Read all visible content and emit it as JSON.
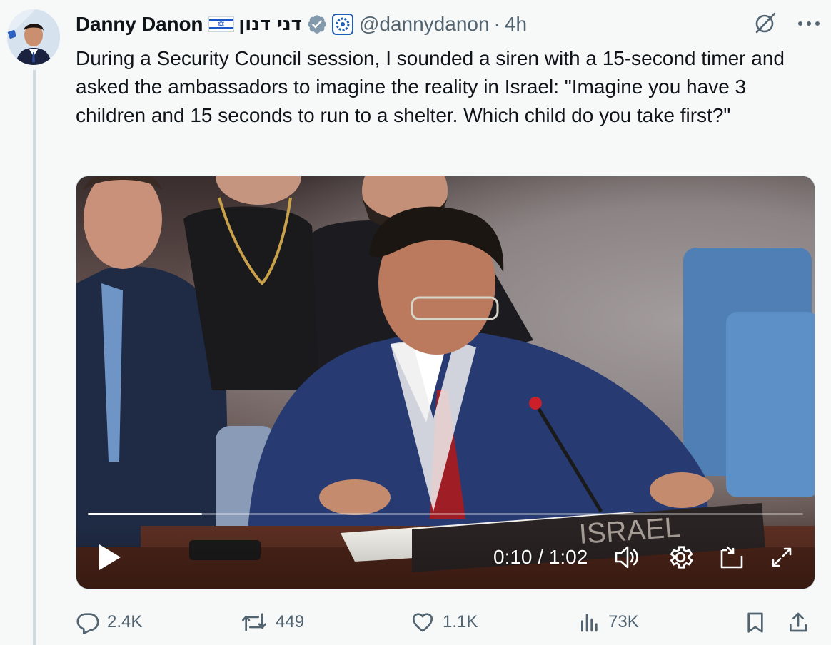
{
  "author": {
    "display_name": "Danny Danon",
    "flag": "israel-flag",
    "hebrew_name": "דני דנון",
    "verified_color": "#829aab",
    "handle": "@dannydanon",
    "separator": "·",
    "time_ago": "4h"
  },
  "tweet": {
    "text": "During a Security Council session, I sounded a siren with a 15-second timer and asked the ambassadors to imagine the reality in Israel: \"Imagine you have 3 children and 15 seconds to run to a shelter. Which child do you take first?\""
  },
  "video": {
    "current_time": "0:10",
    "duration": "1:02",
    "time_display": "0:10 / 1:02",
    "progress_fraction": 0.16,
    "placard_text": "ISRAEL"
  },
  "actions": {
    "reply_count": "2.4K",
    "repost_count": "449",
    "like_count": "1.1K",
    "view_count": "73K"
  },
  "colors": {
    "text_primary": "#0f1419",
    "text_secondary": "#536471",
    "background": "#f7f9f9"
  }
}
